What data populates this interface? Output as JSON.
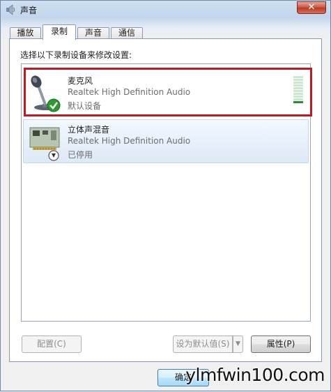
{
  "window": {
    "title": "声音",
    "close_label": "✕"
  },
  "tabs": [
    {
      "label": "播放",
      "active": false
    },
    {
      "label": "录制",
      "active": true
    },
    {
      "label": "声音",
      "active": false
    },
    {
      "label": "通信",
      "active": false
    }
  ],
  "panel": {
    "instruction": "选择以下录制设备来修改设置:"
  },
  "devices": [
    {
      "name": "麦克风",
      "driver": "Realtek High Definition Audio",
      "status": "默认设备",
      "icon": "microphone-icon",
      "badge": "green-check-icon",
      "level_fraction": 0.1
    },
    {
      "name": "立体声混音",
      "driver": "Realtek High Definition Audio",
      "status": "已停用",
      "icon": "sound-card-icon",
      "badge": "disabled-arrow-icon"
    }
  ],
  "buttons": {
    "configure": "配置(C)",
    "set_default": "设为默认值(S)",
    "properties": "属性(P)",
    "ok": "确定"
  },
  "watermark": "ylmfwin100.com",
  "colors": {
    "highlight": "#c0191f",
    "level_on": "#2d8a2d"
  }
}
